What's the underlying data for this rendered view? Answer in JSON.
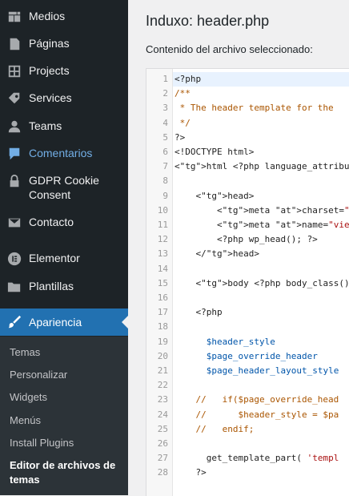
{
  "sidebar": {
    "items": [
      {
        "label": "Medios",
        "icon": "media-icon"
      },
      {
        "label": "Páginas",
        "icon": "pages-icon"
      },
      {
        "label": "Projects",
        "icon": "grid-icon"
      },
      {
        "label": "Services",
        "icon": "tag-icon"
      },
      {
        "label": "Teams",
        "icon": "user-icon"
      },
      {
        "label": "Comentarios",
        "icon": "comment-icon"
      },
      {
        "label": "GDPR Cookie Consent",
        "icon": "lock-icon"
      },
      {
        "label": "Contacto",
        "icon": "mail-icon"
      },
      {
        "label": "Elementor",
        "icon": "elementor-icon"
      },
      {
        "label": "Plantillas",
        "icon": "folder-icon"
      },
      {
        "label": "Apariencia",
        "icon": "brush-icon"
      }
    ],
    "submenu": [
      "Temas",
      "Personalizar",
      "Widgets",
      "Menús",
      "Install Plugins",
      "Editor de archivos de temas"
    ]
  },
  "main": {
    "title": "Induxo: header.php",
    "file_label": "Contenido del archivo seleccionado:"
  },
  "editor": {
    "lines": [
      "<?php",
      "/**",
      " * The header template for the",
      " */",
      "?>",
      "<!DOCTYPE html>",
      "<html <?php language_attributes",
      "",
      "    <head>",
      "        <meta charset=\"<?php bl",
      "        <meta name=\"viewport\" c",
      "        <?php wp_head(); ?>",
      "    </head>",
      "",
      "    <body <?php body_class(); ?",
      "",
      "    <?php",
      "",
      "      $header_style",
      "      $page_override_header",
      "      $page_header_layout_style",
      "",
      "    //   if($page_override_head",
      "    //      $header_style = $pa",
      "    //   endif;",
      "",
      "      get_template_part( 'templ",
      "    ?>"
    ]
  },
  "colors": {
    "sidebar_bg": "#1d2327",
    "submenu_bg": "#2c3338",
    "accent": "#2271b1",
    "link": "#72aee6"
  }
}
